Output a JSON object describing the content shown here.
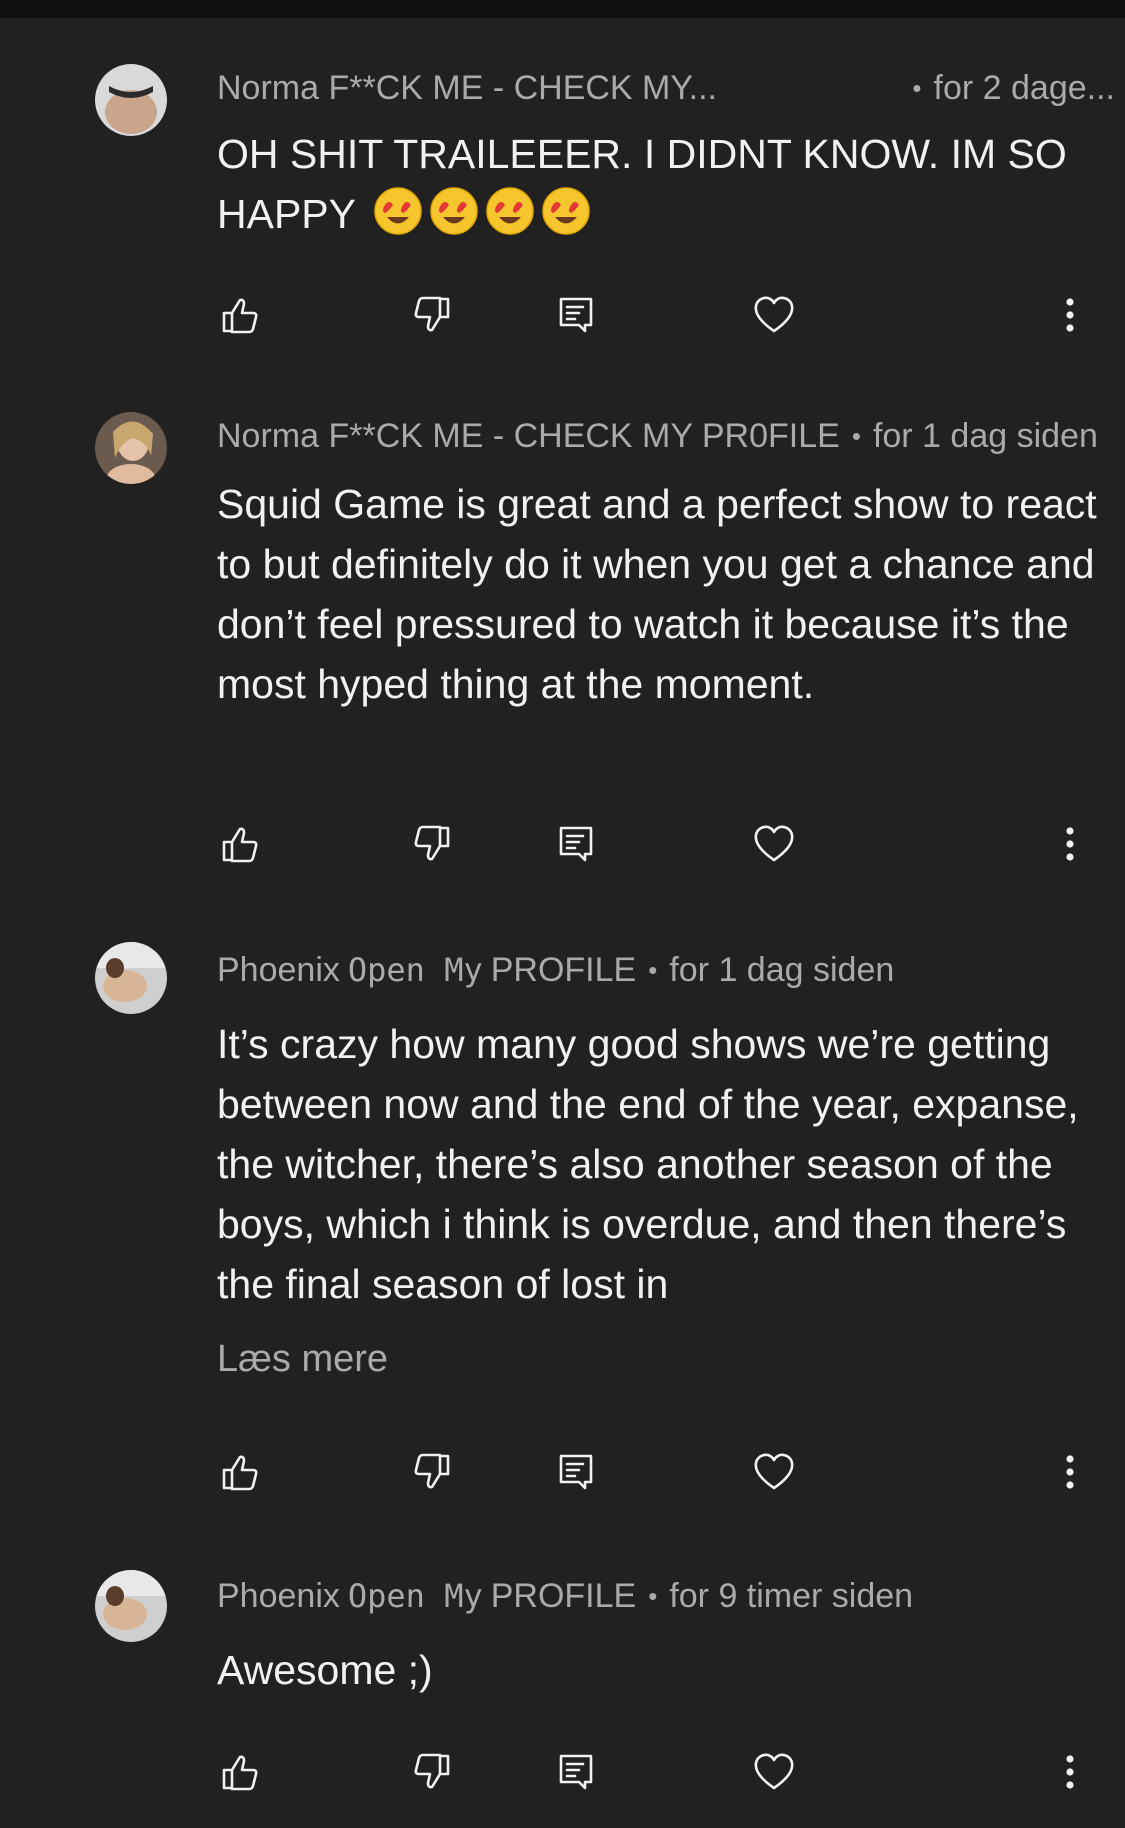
{
  "comments": [
    {
      "author": "Norma F**CK ME - CHECK MY...",
      "time": "for 2 dage...",
      "text": "OH SHIT TRAILEEER. I DIDNT KNOW. IM SO HAPPY",
      "emojis": [
        "heart-eyes-emoji",
        "heart-eyes-emoji",
        "heart-eyes-emoji",
        "heart-eyes-emoji"
      ]
    },
    {
      "author": "Norma F**CK ME - CHECK MY PR0FILE",
      "time": "for 1 dag siden",
      "text": "Squid Game is great and a perfect show to react to but definitely do it when you get a chance and don’t feel pressured to watch it because it’s the most hyped thing at the moment."
    },
    {
      "author_name": "Phoenix",
      "author_fancy": "Open My",
      "author_tail": "PROFILE",
      "time": "for 1 dag siden",
      "text": "It’s crazy how many good shows we’re getting between now and the end of the year, expanse, the witcher, there’s also another season of the boys, which i think is overdue, and then there’s the final season of lost in",
      "read_more": "Læs mere"
    },
    {
      "author_name": "Phoenix",
      "author_fancy": "Open My",
      "author_tail": "PROFILE",
      "time": "for 9 timer siden",
      "text": "Awesome ;)"
    }
  ],
  "separator": "•",
  "icons": {
    "like": "thumbs-up-icon",
    "dislike": "thumbs-down-icon",
    "reply": "reply-icon",
    "heart": "heart-icon",
    "more": "more-vert-icon"
  },
  "colors": {
    "background": "#212121",
    "text": "#f1f1f1",
    "secondary": "#aaaaaa"
  }
}
